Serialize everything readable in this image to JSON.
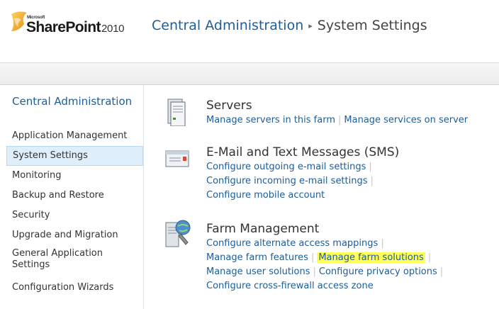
{
  "header": {
    "logo_microsoft": "Microsoft",
    "logo_product": "SharePoint",
    "logo_version": "2010",
    "breadcrumb": {
      "root": "Central Administration",
      "separator": "▸",
      "current": "System Settings"
    }
  },
  "sidebar": {
    "heading": "Central Administration",
    "items": [
      {
        "label": "Application Management",
        "selected": false
      },
      {
        "label": "System Settings",
        "selected": true
      },
      {
        "label": "Monitoring",
        "selected": false
      },
      {
        "label": "Backup and Restore",
        "selected": false
      },
      {
        "label": "Security",
        "selected": false
      },
      {
        "label": "Upgrade and Migration",
        "selected": false
      },
      {
        "label": "General Application Settings",
        "selected": false
      },
      {
        "label": "Configuration Wizards",
        "selected": false
      }
    ]
  },
  "main": {
    "groups": [
      {
        "icon": "servers-icon",
        "title": "Servers",
        "links": [
          "Manage servers in this farm",
          "Manage services on server"
        ]
      },
      {
        "icon": "email-icon",
        "title": "E-Mail and Text Messages (SMS)",
        "links": [
          "Configure outgoing e-mail settings",
          "Configure incoming e-mail settings",
          "Configure mobile account"
        ]
      },
      {
        "icon": "farm-management-icon",
        "title": "Farm Management",
        "links": [
          "Configure alternate access mappings",
          "Manage farm features",
          "Manage farm solutions",
          "Manage user solutions",
          "Configure privacy options",
          "Configure cross-firewall access zone"
        ],
        "highlighted_link": "Manage farm solutions"
      }
    ]
  },
  "colors": {
    "link": "#1f5d97",
    "highlight": "#ffff55",
    "selected_nav_bg": "#dfeefb"
  }
}
